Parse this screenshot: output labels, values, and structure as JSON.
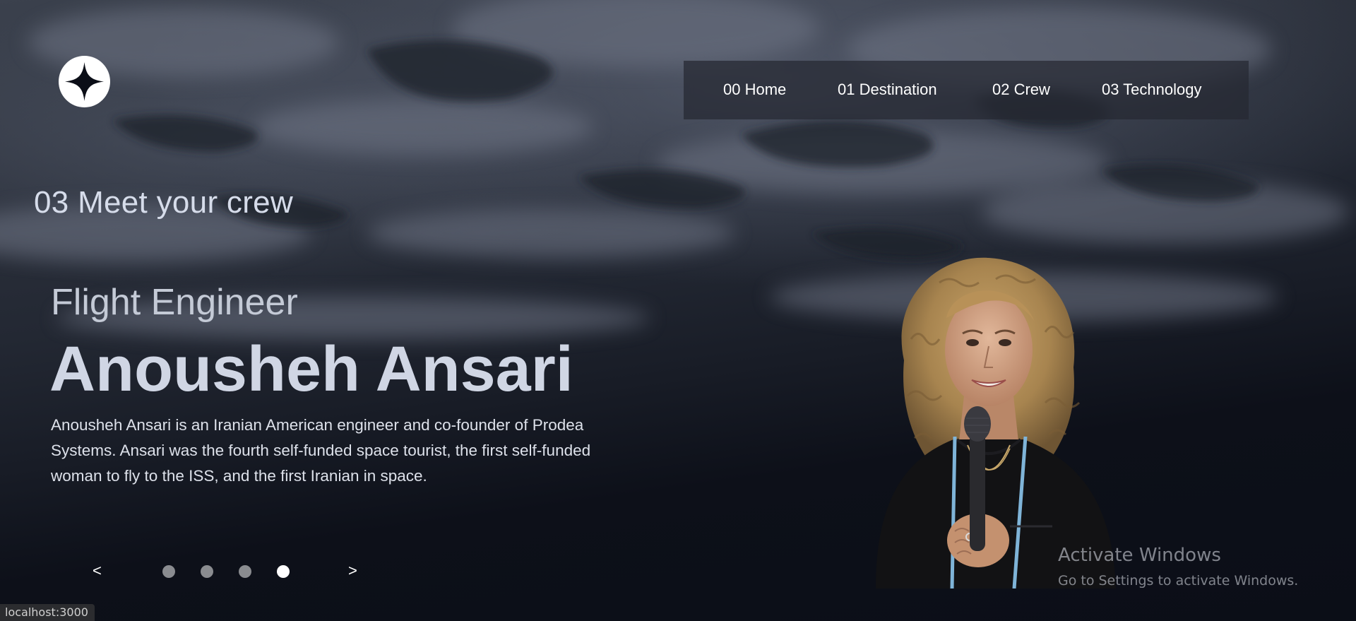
{
  "header": {
    "logo_icon": "four-point-star-icon",
    "nav": [
      {
        "number": "00",
        "label": "00 Home"
      },
      {
        "number": "01",
        "label": "01 Destination"
      },
      {
        "number": "02",
        "label": "02 Crew"
      },
      {
        "number": "03",
        "label": "03 Technology"
      }
    ]
  },
  "main": {
    "heading": "03 Meet your crew",
    "crew": {
      "role": "Flight Engineer",
      "name": "Anousheh Ansari",
      "bio": "Anousheh Ansari is an Iranian American engineer and co-founder of Prodea Systems. Ansari was the fourth self-funded space tourist, the first self-funded woman to fly to the ISS, and the first Iranian in space."
    },
    "carousel": {
      "prev_label": "<",
      "next_label": ">",
      "slide_count": 4,
      "active_index": 3
    }
  },
  "watermark": {
    "title": "Activate Windows",
    "subtitle": "Go to Settings to activate Windows."
  },
  "status_bar": {
    "url": "localhost:3000"
  },
  "colors": {
    "background": "#0b0e17",
    "nav_background": "#252832",
    "text_primary": "#ffffff",
    "text_muted": "#d0d6e4",
    "dot_inactive": "#8a8c90",
    "dot_active": "#ffffff"
  }
}
